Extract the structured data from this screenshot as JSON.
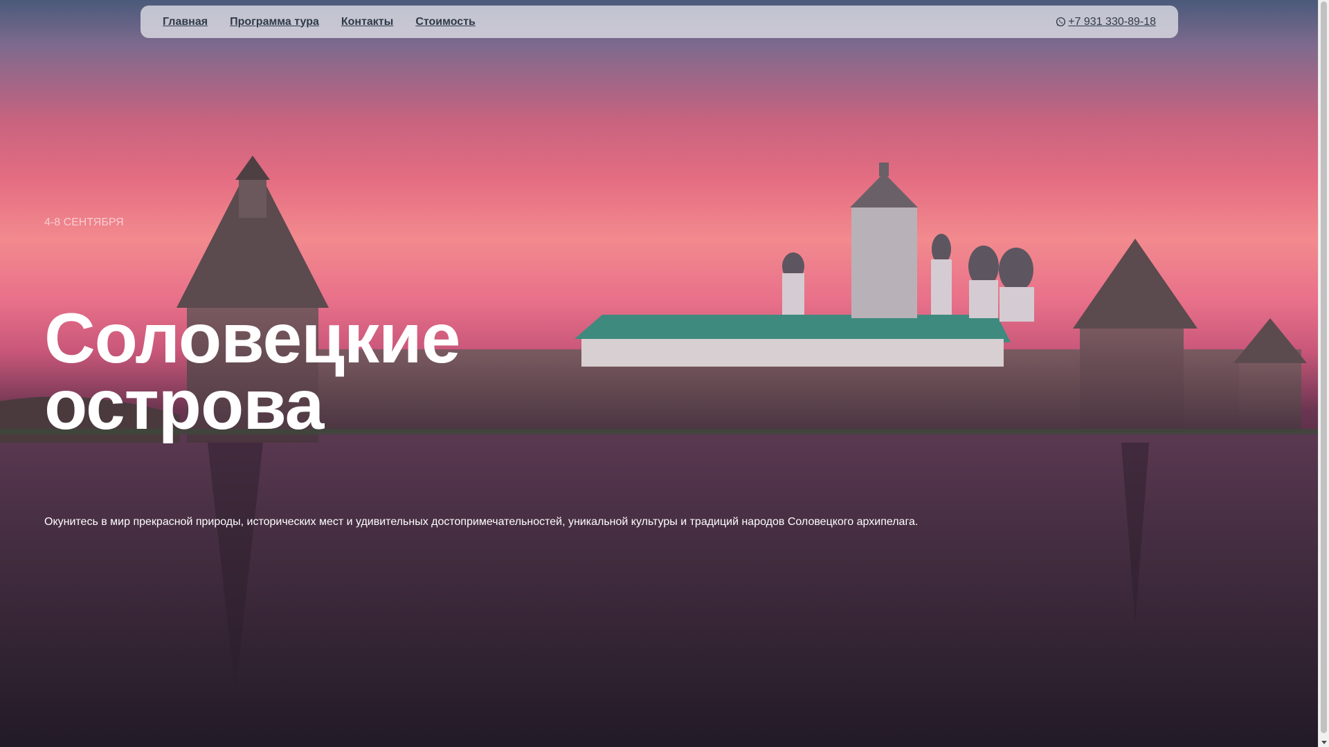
{
  "nav": {
    "items": [
      {
        "label": "Главная"
      },
      {
        "label": "Программа тура"
      },
      {
        "label": "Контакты"
      },
      {
        "label": "Стоимость"
      }
    ],
    "phone": "+7 931 330-89-18",
    "phone_icon": "whatsapp-icon"
  },
  "hero": {
    "date": "4-8 сентября",
    "title_line1": "Соловецкие",
    "title_line2": "острова",
    "subtitle": "Окунитесь в мир прекрасной природы, исторических мест и удивительных достопримечательностей, уникальной культуры и традиций народов Соловецкого архипелага."
  },
  "colors": {
    "nav_text": "#2f3a48",
    "title": "#ffffff",
    "roof_green": "#3f8a7e"
  }
}
